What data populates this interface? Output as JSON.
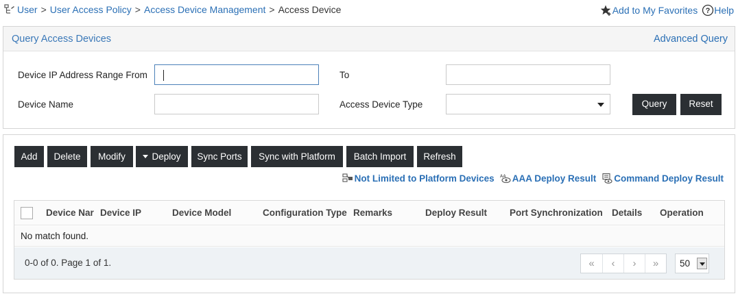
{
  "breadcrumb": {
    "items": [
      "User",
      "User Access Policy",
      "Access Device Management"
    ],
    "separator": ">",
    "current": "Access Device"
  },
  "top_links": {
    "favorites": "Add to My Favorites",
    "help": "Help"
  },
  "query_panel": {
    "title": "Query Access Devices",
    "advanced_query": "Advanced Query",
    "fields": {
      "ip_from_label": "Device IP Address Range From",
      "ip_from_value": "",
      "ip_to_label": "To",
      "ip_to_value": "",
      "device_name_label": "Device Name",
      "device_name_value": "",
      "device_type_label": "Access Device Type",
      "device_type_value": ""
    },
    "query_button": "Query",
    "reset_button": "Reset"
  },
  "toolbar": {
    "add": "Add",
    "delete": "Delete",
    "modify": "Modify",
    "deploy": "Deploy",
    "sync_ports": "Sync Ports",
    "sync_platform": "Sync with Platform",
    "batch_import": "Batch Import",
    "refresh": "Refresh"
  },
  "result_links": {
    "not_limited": "Not Limited to Platform Devices",
    "aaa_deploy": "AAA Deploy Result",
    "command_deploy": "Command Deploy Result"
  },
  "table": {
    "columns": [
      "Device Nar",
      "Device IP",
      "Device Model",
      "Configuration Type",
      "Remarks",
      "Deploy Result",
      "Port Synchronization",
      "Details",
      "Operation"
    ],
    "empty_message": "No match found."
  },
  "pagination": {
    "info": "0-0 of 0. Page 1 of 1.",
    "first": "«",
    "prev": "‹",
    "next": "›",
    "last": "»",
    "page_size": "50"
  },
  "colors": {
    "link": "#2a6fb5",
    "button_bg": "#2b2f33",
    "title": "#3a78b8"
  }
}
